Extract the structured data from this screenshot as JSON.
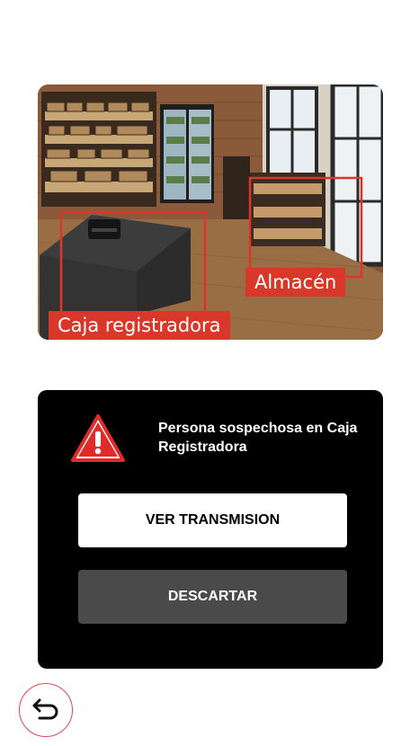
{
  "camera": {
    "zones": {
      "register_label": "Caja registradora",
      "storage_label": "Almacén"
    },
    "zone_color": "#d8372a"
  },
  "alert": {
    "icon": "warning-icon",
    "message": "Persona sospechosa en Caja Registradora",
    "view_button_label": "VER TRANSMISION",
    "dismiss_button_label": "DESCARTAR"
  },
  "nav": {
    "back_icon": "back-arrow-icon"
  },
  "colors": {
    "accent": "#e0474c",
    "card_bg": "#000000",
    "secondary_button": "#4a4a4a"
  }
}
